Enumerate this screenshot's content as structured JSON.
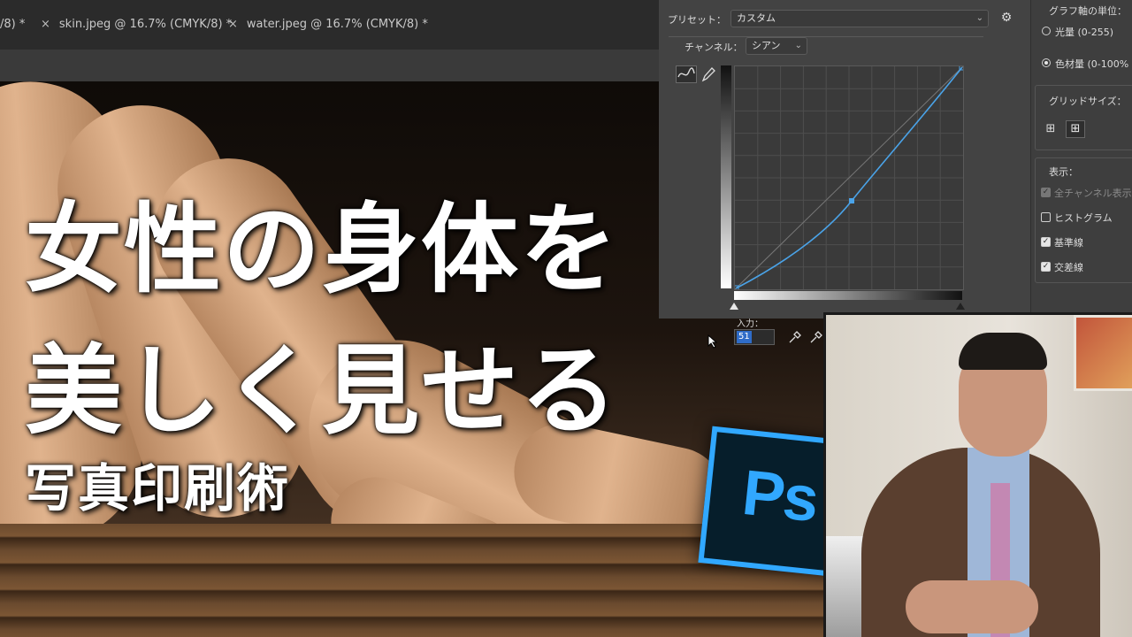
{
  "tabs": [
    {
      "label": "/8) *",
      "close": ""
    },
    {
      "label": "skin.jpeg @ 16.7% (CMYK/8) *",
      "close": "×"
    },
    {
      "label": "water.jpeg @ 16.7% (CMYK/8) *",
      "close": "×"
    }
  ],
  "overlay": {
    "line1": "女性の身体を",
    "line2": "美しく見せる",
    "line3": "写真印刷術"
  },
  "curves": {
    "preset_label": "プリセット：",
    "preset_value": "カスタム",
    "channel_label": "チャンネル：",
    "channel_value": "シアン",
    "input_label": "入力：",
    "input_value": "51",
    "curve_color": "#4aa3e8"
  },
  "options": {
    "unit_header": "グラフ軸の単位：",
    "unit_light": "光量 (0-255)",
    "unit_pigment": "色材量 (0-100%",
    "grid_header": "グリッドサイズ：",
    "display_header": "表示：",
    "show_all_channels": "全チャンネル表示",
    "histogram": "ヒストグラム",
    "baseline": "基準線",
    "intersection": "交差線"
  },
  "logo": {
    "text": "Ps",
    "color": "#31a8ff"
  }
}
